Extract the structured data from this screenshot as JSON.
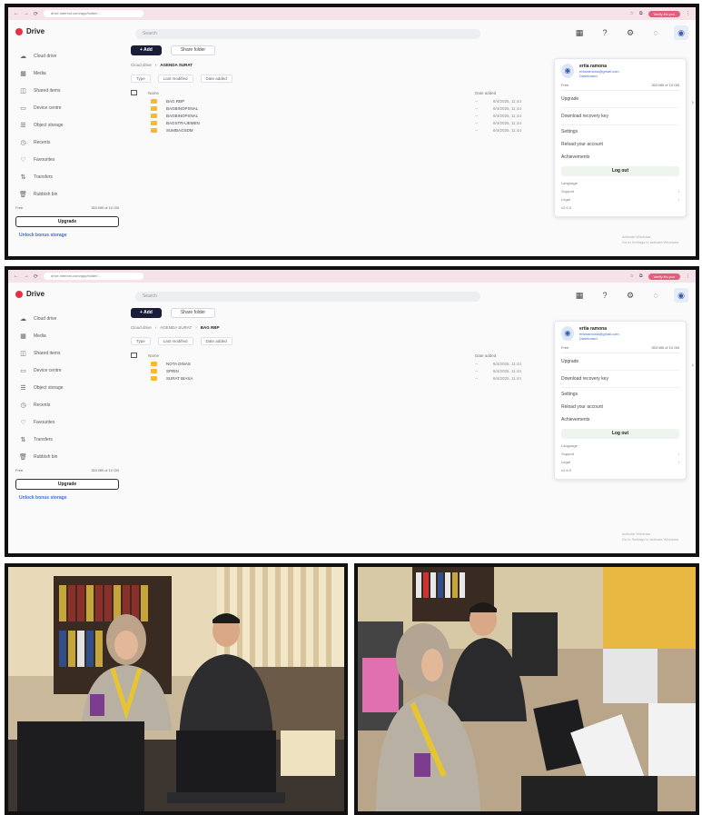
{
  "screens": [
    {
      "browser": {
        "url": "drive.internxt.com/app/folder/...",
        "profile_label": "Verify it's you"
      },
      "app": {
        "brand": "Drive",
        "search_placeholder": "Search",
        "sidebar": [
          {
            "label": "Cloud drive",
            "icon": "cloud-icon"
          },
          {
            "label": "Media",
            "icon": "media-icon"
          },
          {
            "label": "Shared items",
            "icon": "shared-icon"
          },
          {
            "label": "Device centre",
            "icon": "device-icon"
          },
          {
            "label": "Object storage",
            "icon": "storage-icon"
          },
          {
            "label": "Recents",
            "icon": "clock-icon"
          },
          {
            "label": "Favourites",
            "icon": "heart-icon"
          },
          {
            "label": "Transfers",
            "icon": "transfer-icon"
          },
          {
            "label": "Rubbish bin",
            "icon": "trash-icon"
          }
        ],
        "storage_left": "Free",
        "storage_right": "353 MB of 10 GB",
        "upgrade_label": "Upgrade",
        "unlock_label": "Unlock bonus storage",
        "add_label": "+ Add",
        "share_label": "Share folder",
        "breadcrumbs": [
          "Cloud drive",
          "AGENDA SURAT"
        ],
        "filters": [
          "Type",
          "Last modified",
          "Date added"
        ],
        "col_name": "Name",
        "col_date": "Date added",
        "files": [
          {
            "name": "BAG RBP",
            "size": "--",
            "date": "8/4/2025, 11:44"
          },
          {
            "name": "BAGBINOPSNAL",
            "size": "--",
            "date": "8/4/2025, 11:44"
          },
          {
            "name": "BAGBINOPSNAL",
            "size": "--",
            "date": "8/4/2025, 11:44"
          },
          {
            "name": "BAGSTRAJEMEN",
            "size": "--",
            "date": "8/4/2025, 11:44"
          },
          {
            "name": "SUMBAGSDM",
            "size": "--",
            "date": "8/4/2025, 11:44"
          }
        ],
        "menu": {
          "name": "ertia ramona",
          "email": "ertiaramona@gmail.com",
          "dashboard": "Dashboard",
          "plan_left": "Free",
          "plan_right": "353 MB of 10 GB",
          "items_top": [
            "Upgrade",
            "Download recovery key"
          ],
          "items_mid": [
            "Settings",
            "Reload your account",
            "Achievements"
          ],
          "logout": "Log out",
          "language_label": "Language",
          "support": "Support",
          "legal": "Legal",
          "version": "v2.6.5"
        },
        "watermark": [
          "Activate Windows",
          "Go to Settings to activate Windows."
        ]
      }
    },
    {
      "browser": {
        "url": "drive.internxt.com/app/folder/...",
        "profile_label": "Verify it's you"
      },
      "app": {
        "brand": "Drive",
        "search_placeholder": "Search",
        "sidebar": [
          {
            "label": "Cloud drive",
            "icon": "cloud-icon"
          },
          {
            "label": "Media",
            "icon": "media-icon"
          },
          {
            "label": "Shared items",
            "icon": "shared-icon"
          },
          {
            "label": "Device centre",
            "icon": "device-icon"
          },
          {
            "label": "Object storage",
            "icon": "storage-icon"
          },
          {
            "label": "Recents",
            "icon": "clock-icon"
          },
          {
            "label": "Favourites",
            "icon": "heart-icon"
          },
          {
            "label": "Transfers",
            "icon": "transfer-icon"
          },
          {
            "label": "Rubbish bin",
            "icon": "trash-icon"
          }
        ],
        "storage_left": "Free",
        "storage_right": "353 MB of 10 GB",
        "upgrade_label": "Upgrade",
        "unlock_label": "Unlock bonus storage",
        "add_label": "+ Add",
        "share_label": "Share folder",
        "breadcrumbs": [
          "Cloud drive",
          "AGENDA SURAT",
          "BAG RBP"
        ],
        "filters": [
          "Type",
          "Last modified",
          "Date added"
        ],
        "col_name": "Name",
        "col_date": "Date added",
        "files": [
          {
            "name": "NOTA DINAS",
            "size": "--",
            "date": "8/4/2025, 11:44"
          },
          {
            "name": "SPRIN",
            "size": "--",
            "date": "8/4/2025, 11:44"
          },
          {
            "name": "SURAT BIASA",
            "size": "--",
            "date": "8/4/2025, 11:44"
          }
        ],
        "menu": {
          "name": "ertia ramona",
          "email": "ertiaramona@gmail.com",
          "dashboard": "Dashboard",
          "plan_left": "Free",
          "plan_right": "353 MB of 10 GB",
          "items_top": [
            "Upgrade",
            "Download recovery key"
          ],
          "items_mid": [
            "Settings",
            "Reload your account",
            "Achievements"
          ],
          "logout": "Log out",
          "language_label": "Language",
          "support": "Support",
          "legal": "Legal",
          "version": "v2.6.5"
        },
        "watermark": [
          "Activate Windows",
          "Go to Settings to activate Windows."
        ]
      }
    }
  ],
  "icons": {
    "cloud-icon": "☁",
    "media-icon": "▦",
    "shared-icon": "◫",
    "device-icon": "▭",
    "storage-icon": "☰",
    "clock-icon": "◷",
    "heart-icon": "♡",
    "transfer-icon": "⇅",
    "trash-icon": "🗑"
  },
  "colors": {
    "accent": "#e33148",
    "link": "#3d6ed6",
    "folder": "#f5b82e",
    "frame": "#111111"
  }
}
